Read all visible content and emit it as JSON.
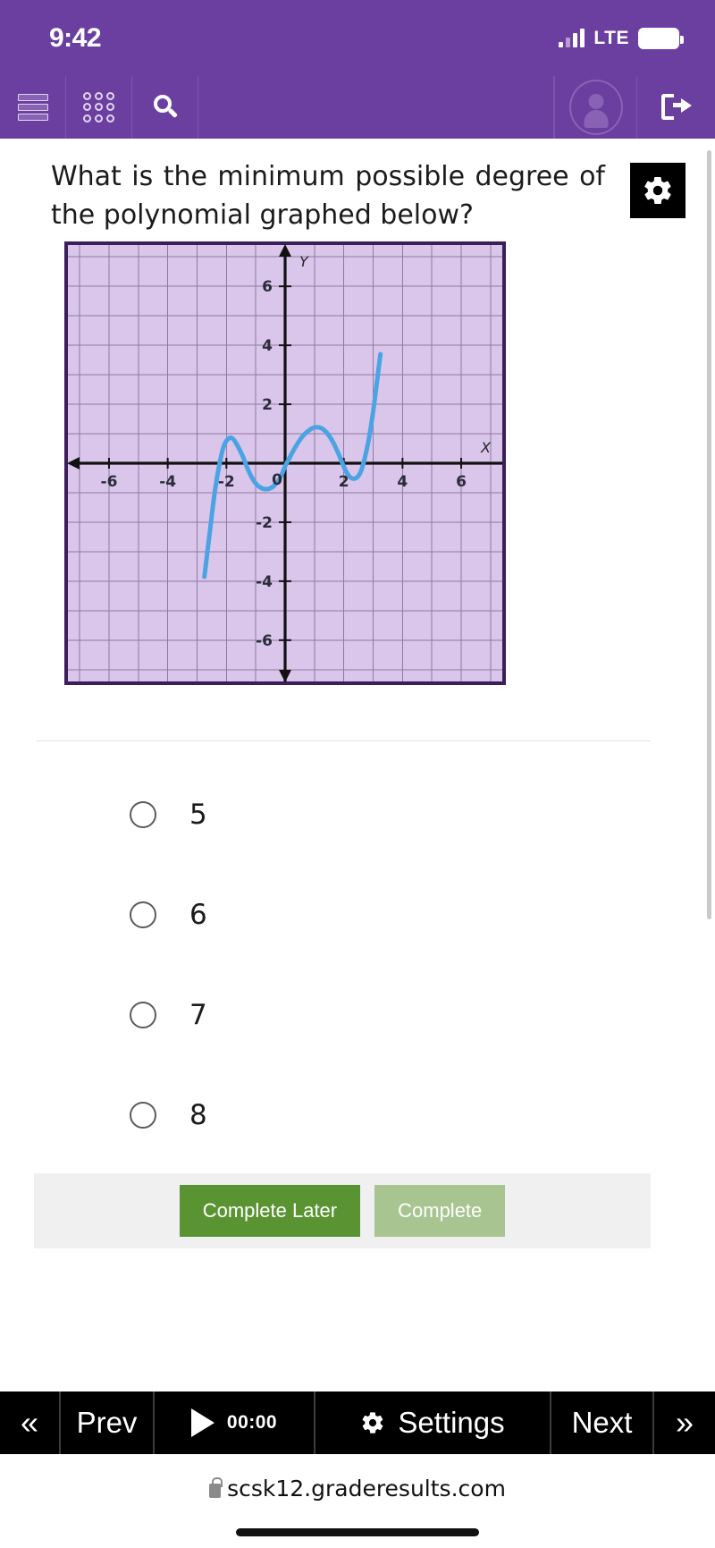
{
  "status_bar": {
    "time": "9:42",
    "network": "LTE",
    "signal_icon": "signal-bars-icon",
    "battery_icon": "battery-icon"
  },
  "app_toolbar": {
    "menu_icon": "list-menu-icon",
    "apps_icon": "grid-apps-icon",
    "search_icon": "search-icon",
    "profile_icon": "user-avatar-icon",
    "logout_icon": "logout-icon",
    "background_color": "#6b3fa0"
  },
  "question": {
    "text": "What is the minimum possible degree of the polynomial graphed below?",
    "settings_badge_icon": "gear-icon"
  },
  "chart_data": {
    "type": "line",
    "title": "",
    "xlabel": "X",
    "ylabel": "Y",
    "xlim": [
      -7.4,
      7.4
    ],
    "ylim": [
      -7.4,
      7.4
    ],
    "x_ticks": [
      -6,
      -4,
      -2,
      0,
      2,
      4,
      6
    ],
    "y_ticks": [
      -6,
      -4,
      -2,
      2,
      4,
      6
    ],
    "x_tick_labels": [
      "-6",
      "-4",
      "-2",
      "0",
      "2",
      "4",
      "6"
    ],
    "y_tick_labels": [
      "-6",
      "-4",
      "-2",
      "2",
      "4",
      "6"
    ],
    "grid": true,
    "legend": "none",
    "plot_background": "#d9c6ea",
    "grid_color": "#8f7aa3",
    "border_color": "#3b1e5a",
    "series": [
      {
        "name": "polynomial",
        "color": "#4ba3e3",
        "points": [
          [
            -2.75,
            -3.85
          ],
          [
            -2.55,
            -2.2
          ],
          [
            -2.4,
            -1.0
          ],
          [
            -2.25,
            -0.1
          ],
          [
            -2.1,
            0.55
          ],
          [
            -1.95,
            0.82
          ],
          [
            -1.8,
            0.85
          ],
          [
            -1.65,
            0.65
          ],
          [
            -1.45,
            0.25
          ],
          [
            -1.25,
            -0.25
          ],
          [
            -1.05,
            -0.62
          ],
          [
            -0.85,
            -0.82
          ],
          [
            -0.65,
            -0.88
          ],
          [
            -0.45,
            -0.82
          ],
          [
            -0.25,
            -0.62
          ],
          [
            -0.1,
            -0.35
          ],
          [
            0.0,
            -0.1
          ],
          [
            0.15,
            0.18
          ],
          [
            0.35,
            0.55
          ],
          [
            0.6,
            0.92
          ],
          [
            0.85,
            1.14
          ],
          [
            1.05,
            1.22
          ],
          [
            1.25,
            1.18
          ],
          [
            1.45,
            1.0
          ],
          [
            1.65,
            0.68
          ],
          [
            1.85,
            0.25
          ],
          [
            2.0,
            -0.12
          ],
          [
            2.15,
            -0.4
          ],
          [
            2.3,
            -0.52
          ],
          [
            2.45,
            -0.48
          ],
          [
            2.58,
            -0.28
          ],
          [
            2.7,
            0.12
          ],
          [
            2.85,
            0.8
          ],
          [
            3.0,
            1.75
          ],
          [
            3.12,
            2.7
          ],
          [
            3.25,
            3.7
          ]
        ],
        "roots_visible": [
          "near -2.2",
          "near 0",
          "near 2 (touch)"
        ],
        "turning_points": 4,
        "left_end_behavior": "falls",
        "right_end_behavior": "rises"
      }
    ]
  },
  "answers": {
    "options": [
      {
        "label": "5",
        "selected": false
      },
      {
        "label": "6",
        "selected": false
      },
      {
        "label": "7",
        "selected": false
      },
      {
        "label": "8",
        "selected": false
      }
    ]
  },
  "complete_bar": {
    "complete_later_label": "Complete Later",
    "complete_label": "Complete",
    "complete_later_color": "#5a9432",
    "complete_color": "#a8c490"
  },
  "bottom_toolbar": {
    "first_icon": "chevron-double-left-icon",
    "prev_label": "Prev",
    "play_icon": "play-icon",
    "timer": "00:00",
    "settings_icon": "gear-icon",
    "settings_label": "Settings",
    "next_label": "Next",
    "last_icon": "chevron-double-right-icon"
  },
  "browser": {
    "lock_icon": "lock-icon",
    "url": "scsk12.graderesults.com"
  }
}
